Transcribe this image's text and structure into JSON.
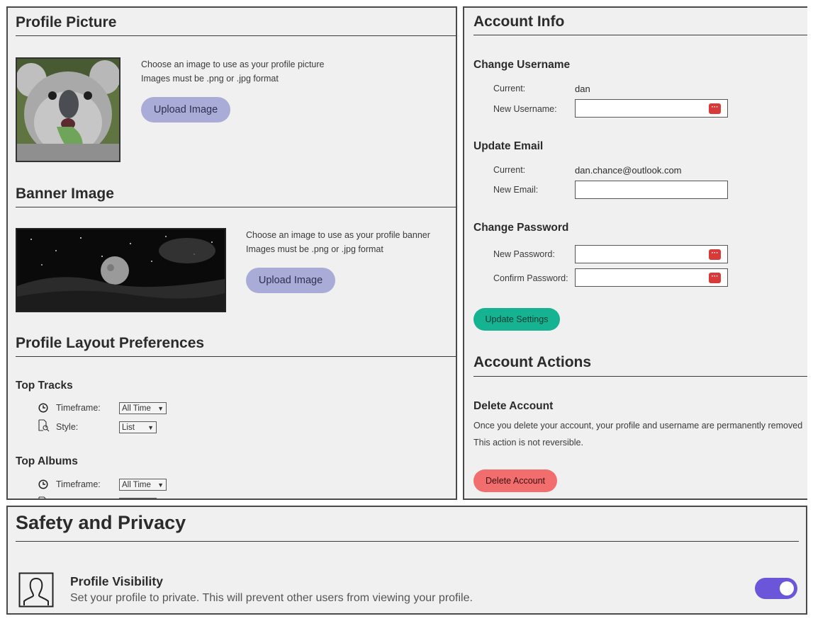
{
  "profile_picture": {
    "title": "Profile Picture",
    "line1": "Choose an image to use as your profile picture",
    "line2": "Images must be .png or .jpg format",
    "button": "Upload Image"
  },
  "banner": {
    "title": "Banner Image",
    "line1": "Choose an image to use as your profile banner",
    "line2": "Images must be .png or .jpg format",
    "button": "Upload Image"
  },
  "layout_prefs": {
    "title": "Profile Layout Preferences",
    "top_tracks": {
      "title": "Top Tracks",
      "timeframe_label": "Timeframe:",
      "timeframe_value": "All Time",
      "style_label": "Style:",
      "style_value": "List"
    },
    "top_albums": {
      "title": "Top Albums",
      "timeframe_label": "Timeframe:",
      "timeframe_value": "All Time"
    }
  },
  "account_info": {
    "title": "Account Info",
    "username": {
      "title": "Change Username",
      "current_label": "Current:",
      "current_value": "dan",
      "new_label": "New Username:"
    },
    "email": {
      "title": "Update Email",
      "current_label": "Current:",
      "current_value": "dan.chance@outlook.com",
      "new_label": "New Email:"
    },
    "password": {
      "title": "Change Password",
      "new_label": "New Password:",
      "confirm_label": "Confirm Password:"
    },
    "update_button": "Update Settings"
  },
  "account_actions": {
    "title": "Account Actions",
    "delete_title": "Delete Account",
    "delete_line1": "Once you delete your account, your profile and username are permanently removed",
    "delete_line2": "This action is not reversible.",
    "delete_button": "Delete Account"
  },
  "privacy": {
    "title": "Safety and Privacy",
    "visibility_title": "Profile Visibility",
    "visibility_desc": "Set your profile to private. This will prevent other users from viewing your profile.",
    "visibility_on": true
  },
  "colors": {
    "upload_button": "#a9acd6",
    "update_button": "#15b391",
    "delete_button": "#f26d6d",
    "toggle_on": "#6b56d9",
    "password_badge": "#d83a3a"
  },
  "icons": [
    "clock-icon",
    "document-search-icon",
    "user-silhouette-icon",
    "chevron-down-icon",
    "password-manager-icon"
  ]
}
